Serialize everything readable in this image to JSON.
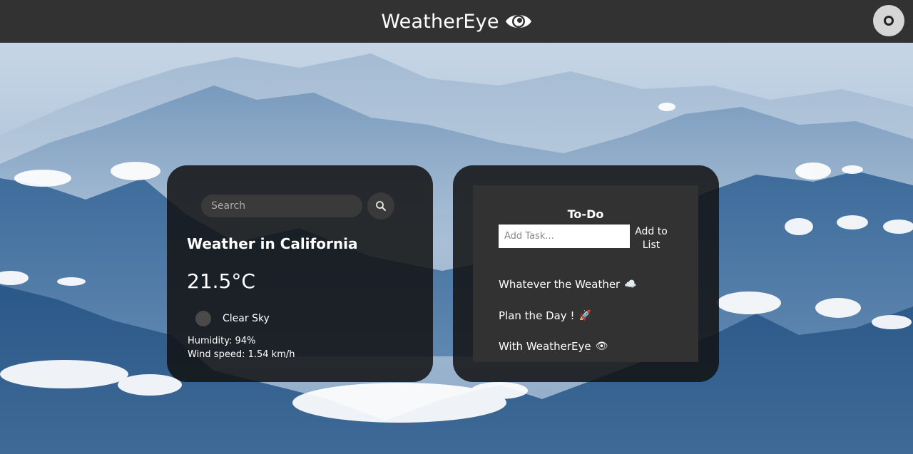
{
  "header": {
    "title": "WeatherEye",
    "logo_icon": "eye-icon",
    "theme_toggle_icon": "theme-toggle-icon"
  },
  "weather": {
    "search_placeholder": "Search",
    "search_icon": "search-icon",
    "title": "Weather in California",
    "temperature": "21.5°C",
    "condition_icon": "weather-condition-icon",
    "description": "Clear Sky",
    "humidity": "Humidity: 94%",
    "wind": "Wind speed: 1.54 km/h"
  },
  "todo": {
    "title": "To-Do",
    "input_placeholder": "Add Task...",
    "add_label_line1": "Add to",
    "add_label_line2": "List",
    "items": [
      {
        "text": "Whatever the Weather",
        "emoji": "☁️"
      },
      {
        "text": "Plan the Day !",
        "emoji": "🚀"
      },
      {
        "text": "With WeatherEye",
        "emoji": "👁"
      }
    ]
  },
  "colors": {
    "topbar": "#323232",
    "card": "#121212",
    "panel": "#323232",
    "text": "#ffffff"
  }
}
